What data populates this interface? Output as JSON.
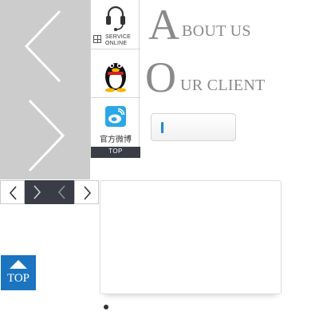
{
  "service_bar": {
    "online_label": "SERVICE\nONLINE",
    "online_line1": "SERVICE",
    "online_line2": "ONLINE",
    "weibo_label": "官方微博",
    "top_label": "TOP"
  },
  "about": {
    "initial": "A",
    "rest": "BOUT US"
  },
  "client": {
    "initial": "O",
    "rest": "UR CLIENT"
  },
  "top_button": {
    "label": "TOP"
  },
  "colors": {
    "panel_grey": "#cccccc",
    "dark_nav": "#3a3d45",
    "accent_blue": "#1a74c0"
  },
  "icons": {
    "slider_prev": "chevron-left-icon",
    "slider_next": "chevron-right-icon",
    "online": "headset-icon",
    "qq": "qq-penguin-icon",
    "weibo": "weibo-icon",
    "top": "arrow-up-icon"
  }
}
